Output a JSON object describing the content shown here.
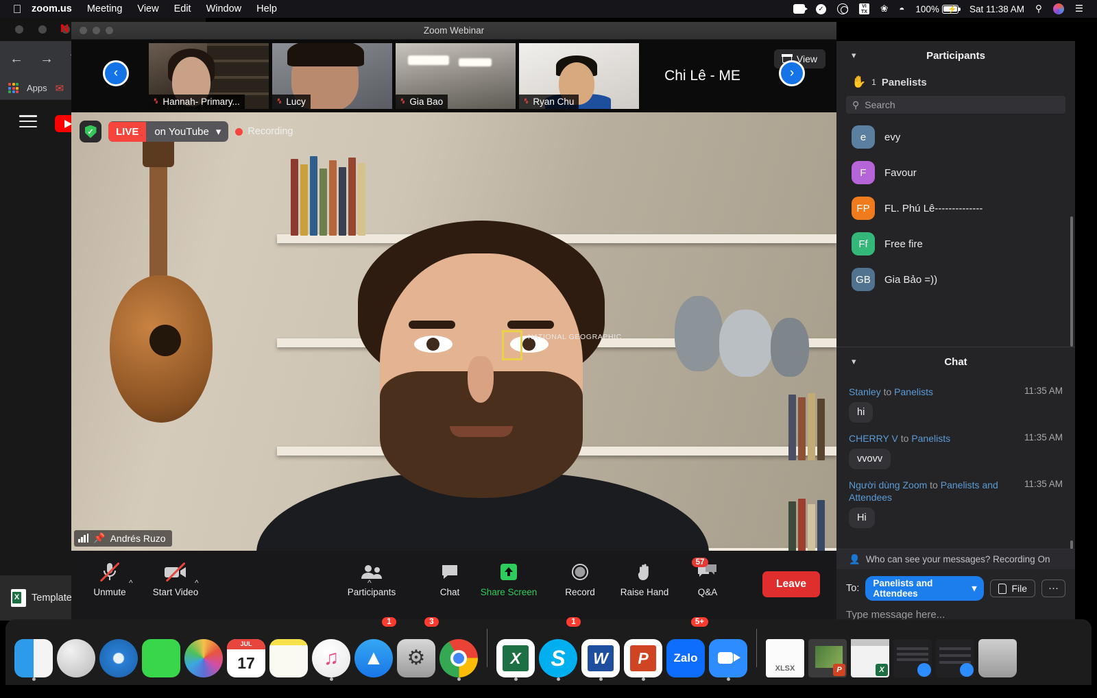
{
  "menubar": {
    "apple_icon": "apple-icon",
    "items": [
      {
        "label": "zoom.us",
        "bold": true
      },
      {
        "label": "Meeting",
        "bold": false
      },
      {
        "label": "View",
        "bold": false
      },
      {
        "label": "Edit",
        "bold": false
      },
      {
        "label": "Window",
        "bold": false
      },
      {
        "label": "Help",
        "bold": false
      }
    ],
    "status": {
      "zoom_icon": "zoom-camera-icon",
      "check_icon": "checkmark-circle-icon",
      "creative_cloud_icon": "adobe-creative-cloud-icon",
      "vitx_icon": "vitx-icon",
      "bluetooth_icon": "bluetooth-icon",
      "wifi_icon": "wifi-icon",
      "battery_percent": "100%",
      "battery_icon": "battery-charging-icon",
      "clock": "Sat 11:38 AM",
      "search_icon": "spotlight-search-icon",
      "siri_icon": "siri-icon",
      "control_center_icon": "control-center-icon"
    }
  },
  "background": {
    "browser_name": "youtube-window",
    "bookmarks_label": "Apps",
    "taskbar_item": "Template"
  },
  "window": {
    "title": "Zoom Webinar"
  },
  "filmstrip": {
    "prev_label": "‹",
    "next_label": "›",
    "view_label": "View",
    "thumbnails": [
      {
        "name": "Hannah- Primary...",
        "muted": true
      },
      {
        "name": "Lucy",
        "muted": true
      },
      {
        "name": "Gia Bao",
        "muted": true
      },
      {
        "name": "Ryan Chu",
        "muted": true
      },
      {
        "name": "Chi Lê - ME",
        "muted": true
      }
    ]
  },
  "stage": {
    "live_badge": "LIVE",
    "live_platform": "on YouTube",
    "recording_label": "Recording",
    "speaker_name": "Andrés Ruzo",
    "shirt_brand": "NATIONAL GEOGRAPHIC"
  },
  "toolbar": {
    "buttons": [
      {
        "name": "unmute",
        "label": "Unmute",
        "icon": "microphone-muted-icon",
        "has_caret": true
      },
      {
        "name": "start-video",
        "label": "Start Video",
        "icon": "video-camera-muted-icon",
        "has_caret": true
      },
      {
        "name": "participants",
        "label": "Participants",
        "icon": "participants-icon",
        "has_caret": true
      },
      {
        "name": "chat",
        "label": "Chat",
        "icon": "chat-bubble-icon",
        "has_caret": false
      },
      {
        "name": "share-screen",
        "label": "Share Screen",
        "icon": "share-screen-icon",
        "has_caret": false
      },
      {
        "name": "record",
        "label": "Record",
        "icon": "record-circle-icon",
        "has_caret": false
      },
      {
        "name": "raise-hand",
        "label": "Raise Hand",
        "icon": "raised-hand-icon",
        "has_caret": false
      },
      {
        "name": "qa",
        "label": "Q&A",
        "icon": "qa-bubbles-icon",
        "has_caret": false,
        "badge": "57"
      }
    ],
    "leave_label": "Leave",
    "share_color": "#2ecc5c",
    "leave_color": "#e02d2d"
  },
  "participants_panel": {
    "title": "Participants",
    "collapse_icon": "chevron-down-icon",
    "section_label": "Panelists",
    "raised_hand_icon": "raised-hand-emoji",
    "raised_hand_count": "1",
    "search_placeholder": "Search",
    "search_icon": "search-icon",
    "people": [
      {
        "initials": "e",
        "name": "evy",
        "color": "#5b7f9e"
      },
      {
        "initials": "F",
        "name": "Favour",
        "color": "#b565d8"
      },
      {
        "initials": "FP",
        "name": "FL. Phú Lê--------------",
        "color": "#ef7b1d"
      },
      {
        "initials": "Ff",
        "name": "Free fire",
        "color": "#33b87a"
      },
      {
        "initials": "GB",
        "name": "Gia Bảo =))",
        "color": "#52738f"
      }
    ]
  },
  "chat_panel": {
    "title": "Chat",
    "collapse_icon": "chevron-down-icon",
    "messages": [
      {
        "sender": "Stanley",
        "to": "Panelists",
        "time": "11:35 AM",
        "text": "hi"
      },
      {
        "sender": "CHERRY V",
        "to": "Panelists",
        "time": "11:35 AM",
        "text": "vvovv"
      },
      {
        "sender": "Người dùng Zoom",
        "to": "Panelists and Attendees",
        "time": "11:35 AM",
        "text": "Hi"
      }
    ],
    "to_word": "to",
    "privacy_notice": "Who can see your messages? Recording On",
    "privacy_icon": "person-info-icon",
    "to_label": "To:",
    "to_target": "Panelists and Attendees",
    "to_caret_icon": "chevron-down-icon",
    "file_label": "File",
    "file_icon": "file-icon",
    "more_label": "···",
    "input_placeholder": "Type message here...",
    "accent_color": "#1c7ded"
  },
  "dock": {
    "items": [
      {
        "name": "finder",
        "label": "Finder",
        "badge": "",
        "running": true
      },
      {
        "name": "launchpad",
        "label": "Launchpad",
        "badge": "",
        "running": false
      },
      {
        "name": "safari",
        "label": "Safari",
        "badge": "",
        "running": false
      },
      {
        "name": "facetime",
        "label": "FaceTime",
        "badge": "",
        "running": false
      },
      {
        "name": "photos",
        "label": "Photos",
        "badge": "",
        "running": false
      },
      {
        "name": "calendar",
        "label": "JUL 17",
        "badge": "",
        "running": false
      },
      {
        "name": "notes",
        "label": "Notes",
        "badge": "",
        "running": false
      },
      {
        "name": "itunes",
        "label": "Music",
        "badge": "",
        "running": true
      },
      {
        "name": "app-store",
        "label": "App Store",
        "badge": "1",
        "running": false
      },
      {
        "name": "system-preferences",
        "label": "System Preferences",
        "badge": "3",
        "running": false
      },
      {
        "name": "chrome",
        "label": "Google Chrome",
        "badge": "",
        "running": true
      },
      {
        "name": "excel",
        "label": "Microsoft Excel",
        "badge": "",
        "running": true
      },
      {
        "name": "skype",
        "label": "Skype",
        "badge": "1",
        "running": true
      },
      {
        "name": "word",
        "label": "Microsoft Word",
        "badge": "",
        "running": true
      },
      {
        "name": "powerpoint",
        "label": "PowerPoint",
        "badge": "",
        "running": true
      },
      {
        "name": "zalo",
        "label": "Zalo",
        "badge": "5+",
        "running": false
      },
      {
        "name": "zoom",
        "label": "zoom.us",
        "badge": "",
        "running": true
      },
      {
        "name": "xlsx-file",
        "label": "XLSX",
        "badge": "",
        "running": false
      },
      {
        "name": "pptx-window",
        "label": "PowerPoint window",
        "badge": "",
        "running": false
      },
      {
        "name": "xlsx-window",
        "label": "Excel window",
        "badge": "",
        "running": false
      },
      {
        "name": "zoom-window-1",
        "label": "Zoom window",
        "badge": "",
        "running": false
      },
      {
        "name": "zoom-window-2",
        "label": "Zoom window",
        "badge": "",
        "running": false
      },
      {
        "name": "trash",
        "label": "Trash",
        "badge": "",
        "running": false
      }
    ]
  }
}
